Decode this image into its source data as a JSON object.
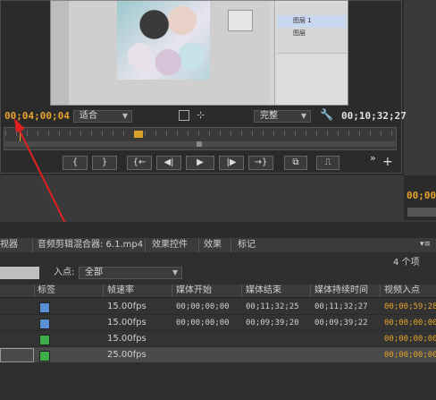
{
  "monitor": {
    "timecode_left": "00;04;00;04",
    "timecode_right": "00;10;32;27",
    "fit_dropdown": "适合",
    "quality_dropdown": "完整",
    "controls": [
      "{",
      "}",
      "{←",
      "◀|",
      "▶",
      "|▶",
      "→}"
    ],
    "colors": {
      "timecode_orange": "#e8a32a",
      "playhead": "#d9a02a"
    }
  },
  "ps_window": {
    "layer_label": "图层",
    "layer_name": "图层 1"
  },
  "right_cutoff": {
    "timecode": "00;00"
  },
  "project": {
    "tabs": [
      "视器",
      "音频剪辑混合器: 6.1.mp4",
      "效果控件",
      "效果",
      "标记"
    ],
    "item_count": "4 个项",
    "in_point_label": "入点:",
    "in_point_value": "全部",
    "columns": [
      "标签",
      "帧速率",
      "媒体开始",
      "媒体结束",
      "媒体持续时间",
      "视频入点"
    ],
    "rows": [
      {
        "color": "#5a8fd4",
        "rate": "15.00fps",
        "start": "00;00;00;00",
        "end": "00;11;32;25",
        "duration": "00;11;32;27",
        "in": "00;00;59;28"
      },
      {
        "color": "#5a8fd4",
        "rate": "15.00fps",
        "start": "00;00;00;00",
        "end": "00;09;39;20",
        "duration": "00;09;39;22",
        "in": "00;00;00;00"
      },
      {
        "color": "#3fae4a",
        "rate": "15.00fps",
        "start": "",
        "end": "",
        "duration": "",
        "in": "00;00;00;00"
      },
      {
        "color": "#3fae4a",
        "rate": "25.00fps",
        "start": "",
        "end": "",
        "duration": "",
        "in": "00;00;00;00"
      }
    ]
  }
}
